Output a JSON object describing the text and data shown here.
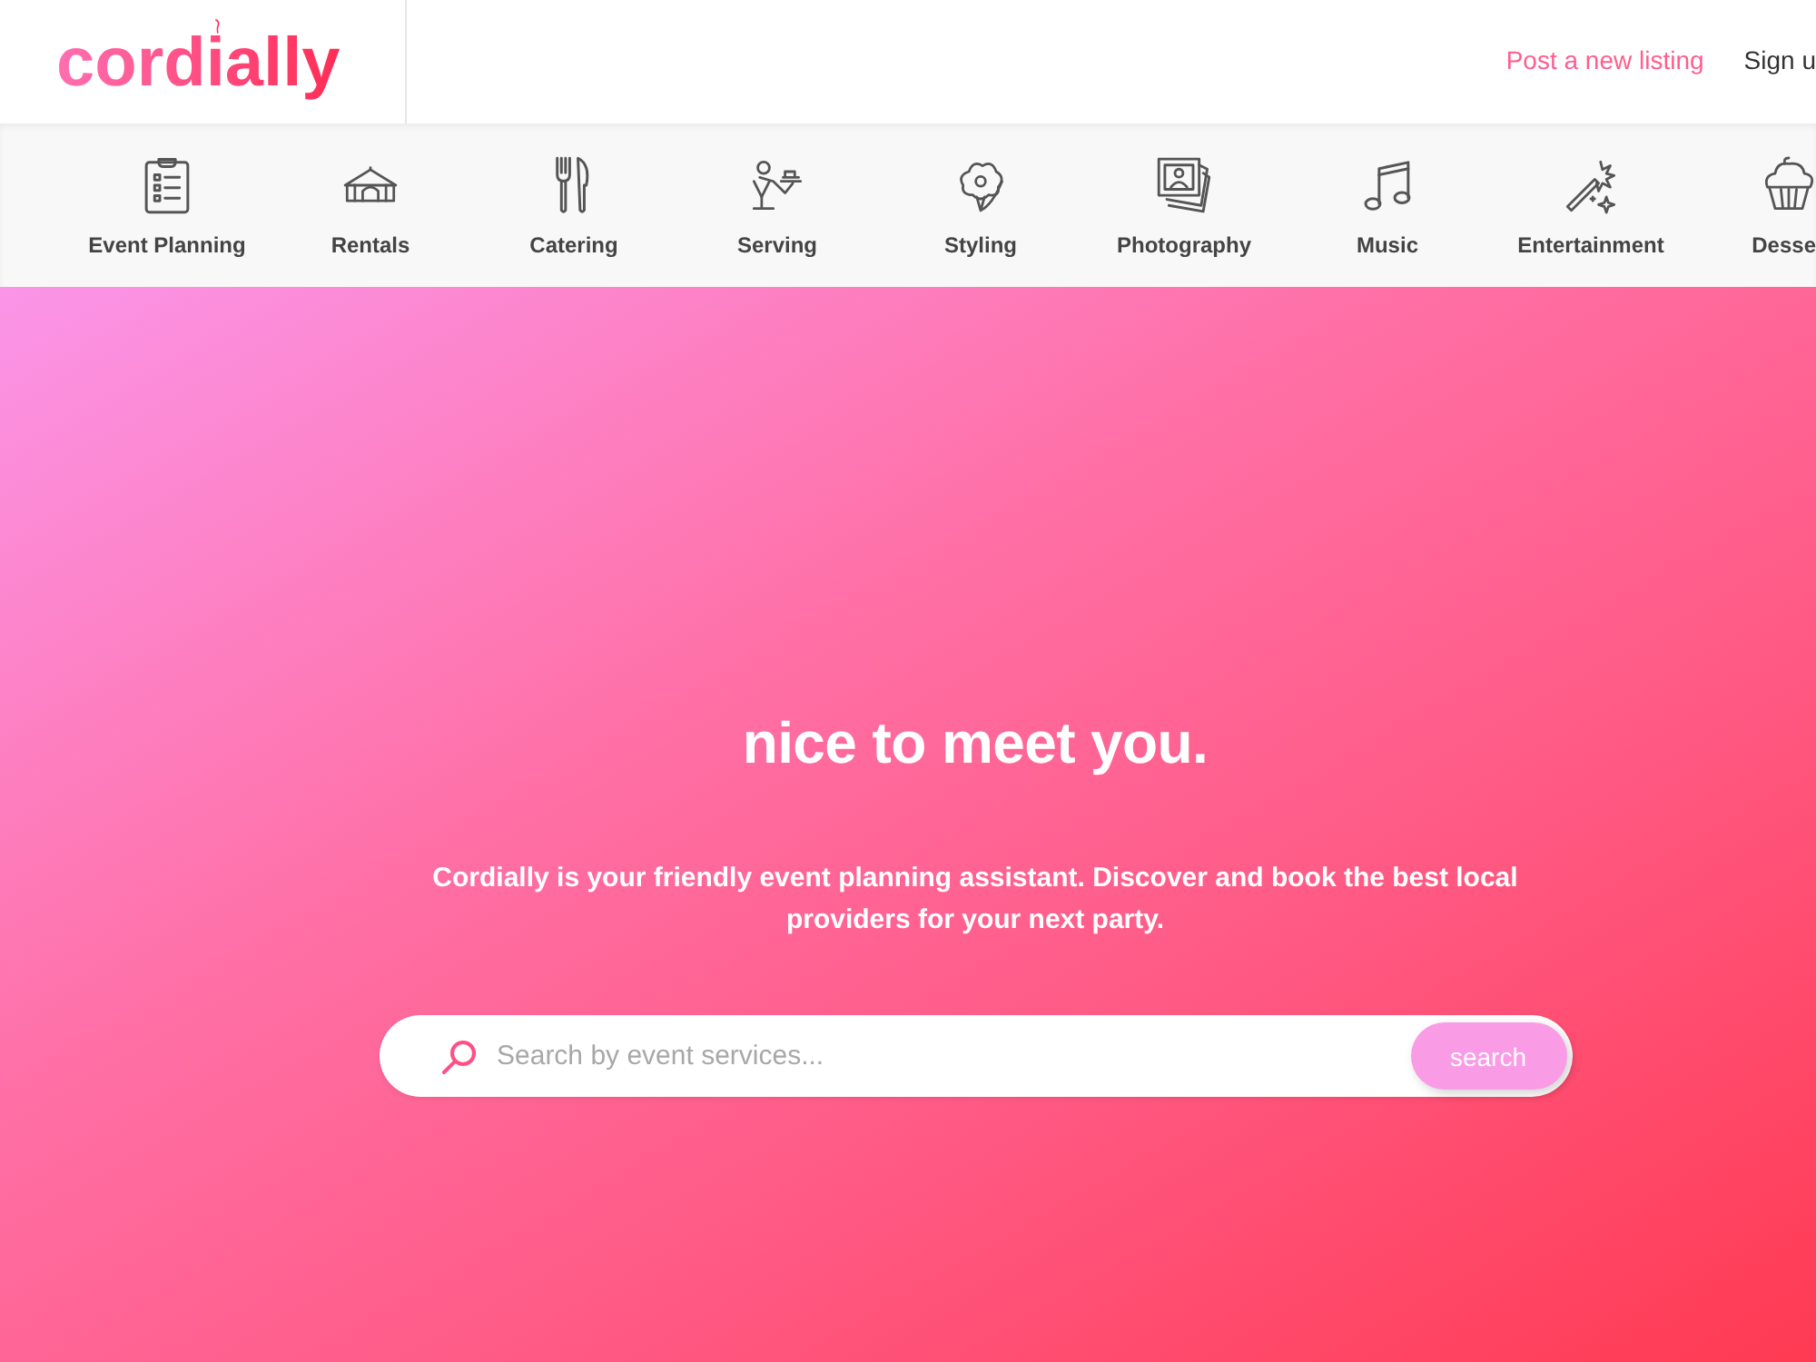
{
  "header": {
    "logo": "cordially",
    "links": [
      {
        "label": "Post a new listing",
        "kind": "accent"
      },
      {
        "label": "Sign u",
        "kind": "plain"
      }
    ]
  },
  "categories": [
    "Event Planning",
    "Rentals",
    "Catering",
    "Serving",
    "Styling",
    "Photography",
    "Music",
    "Entertainment",
    "Desse"
  ],
  "hero": {
    "heading": "nice to meet you.",
    "description": "Cordially is your friendly event planning assistant. Discover and book the best local providers for your next party.",
    "search": {
      "placeholder": "Search by event services...",
      "button": "search"
    }
  }
}
